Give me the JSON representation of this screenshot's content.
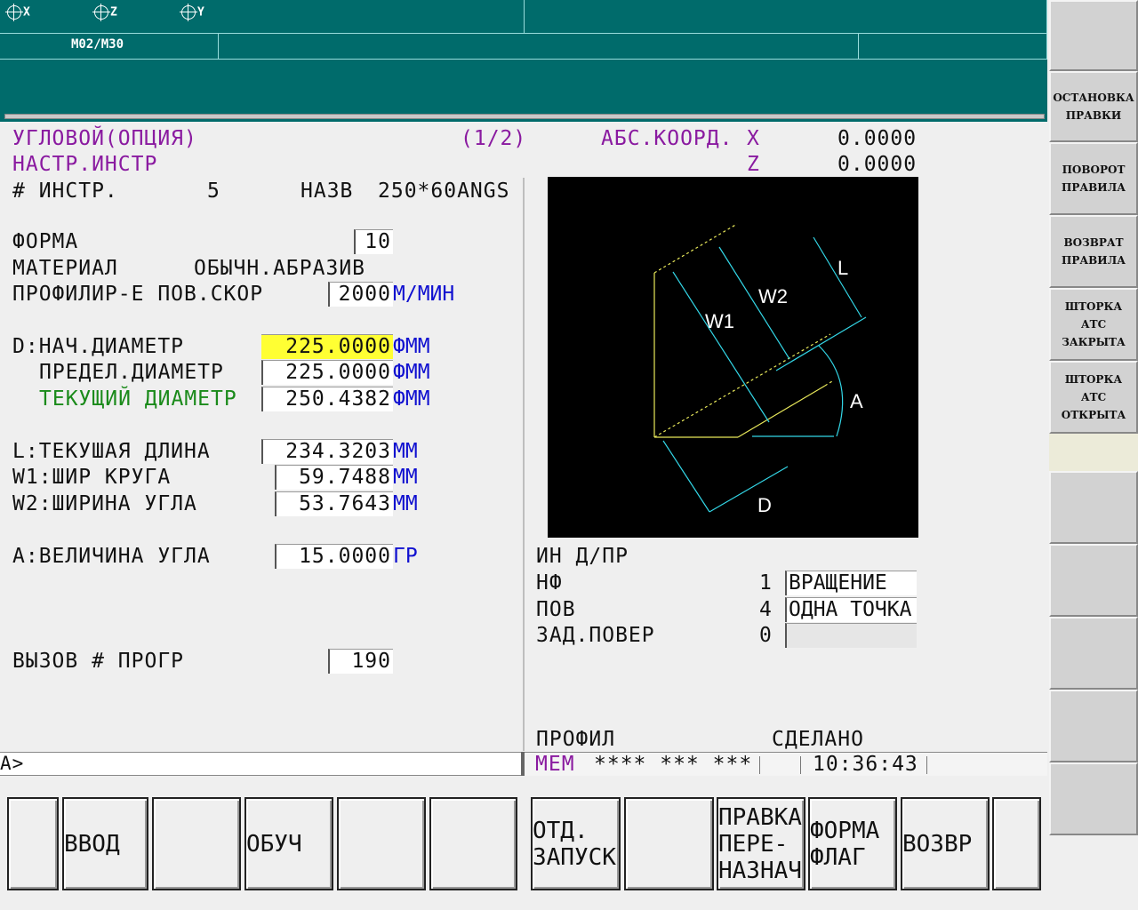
{
  "topbar": {
    "axes": [
      "X",
      "Z",
      "Y"
    ],
    "mode_code": "M02/M30"
  },
  "side_keys": [
    "",
    "ОСТАНОВКА\nПРАВКИ",
    "ПОВОРОТ\nПРАВИЛА",
    "ВОЗВРАТ\nПРАВИЛА",
    "ШТОРКА\nАТС\nЗАКРЫТА",
    "ШТОРКА\nАТС\nОТКРЫТА",
    "",
    "",
    "",
    "",
    "",
    ""
  ],
  "header": {
    "title": "УГЛОВОЙ(ОПЦИЯ)",
    "subtitle": "НАСТР.ИНСТР",
    "page": "(1/2)",
    "coord_label": "АБС.КООРД.",
    "x_label": "X",
    "x_value": "0.0000",
    "z_label": "Z",
    "z_value": "0.0000"
  },
  "tool": {
    "label": "# ИНСТР.",
    "number": "5",
    "name_label": "НАЗВ",
    "name": "250*60ANGS"
  },
  "fields": {
    "shape_label": "ФОРМА",
    "shape_value": "10",
    "material_label": "МАТЕРИАЛ",
    "material_value": "ОБЫЧН.АБРАЗИВ",
    "speed_label": "ПРОФИЛИР-Е ПОВ.СКОР",
    "speed_value": "2000",
    "speed_unit": "М/МИН",
    "start_dia_label": "D:НАЧ.ДИАМЕТР",
    "start_dia_value": "225.0000",
    "limit_dia_label": "ПРЕДЕЛ.ДИАМЕТР",
    "limit_dia_value": "225.0000",
    "cur_dia_label": "ТЕКУЩИЙ ДИАМЕТР",
    "cur_dia_value": "250.4382",
    "dia_unit": "ФММ",
    "len_label": "L:ТЕКУШАЯ ДЛИНА",
    "len_value": "234.3203",
    "w1_label": "W1:ШИР КРУГА",
    "w1_value": "59.7488",
    "w2_label": "W2:ШИРИНА УГЛА",
    "w2_value": "53.7643",
    "mm_unit": "ММ",
    "angle_label": "A:ВЕЛИЧИНА УГЛА",
    "angle_value": "15.0000",
    "angle_unit": "ГР",
    "prog_label": "ВЫЗОВ # ПРОГР",
    "prog_value": "190"
  },
  "diagram": {
    "labels": [
      "L",
      "W2",
      "W1",
      "A",
      "D"
    ]
  },
  "right_panel": {
    "title": "ИН Д/ПР",
    "rows": [
      {
        "label": "НФ",
        "num": "1",
        "value": "ВРАЩЕНИЕ"
      },
      {
        "label": "ПОВ",
        "num": "4",
        "value": "ОДНА ТОЧКА"
      },
      {
        "label": "ЗАД.ПОВЕР",
        "num": "0",
        "value": ""
      }
    ],
    "profile_label": "ПРОФИЛ",
    "done_label": "СДЕЛАНО"
  },
  "command_line": "A>",
  "status": {
    "mode": "MEM",
    "stars": "**** *** ***",
    "time": "10:36:43"
  },
  "softkeys": [
    "",
    "ВВОД",
    "",
    "ОБУЧ",
    "",
    "",
    "ОТД.\nЗАПУСК",
    "",
    "ПРАВКА\nПЕРЕ-\nНАЗНАЧ",
    "ФОРМА\nФЛАГ",
    "ВОЗВР",
    ""
  ],
  "colors": {
    "topbar": "#006b6b",
    "highlight_field": "#ffff33",
    "header_text": "#8a1aa0",
    "unit_text": "#1010d0",
    "current_text": "#1a8a1a",
    "diagram_yellow": "#e8e85a",
    "diagram_cyan": "#33d6e6"
  }
}
